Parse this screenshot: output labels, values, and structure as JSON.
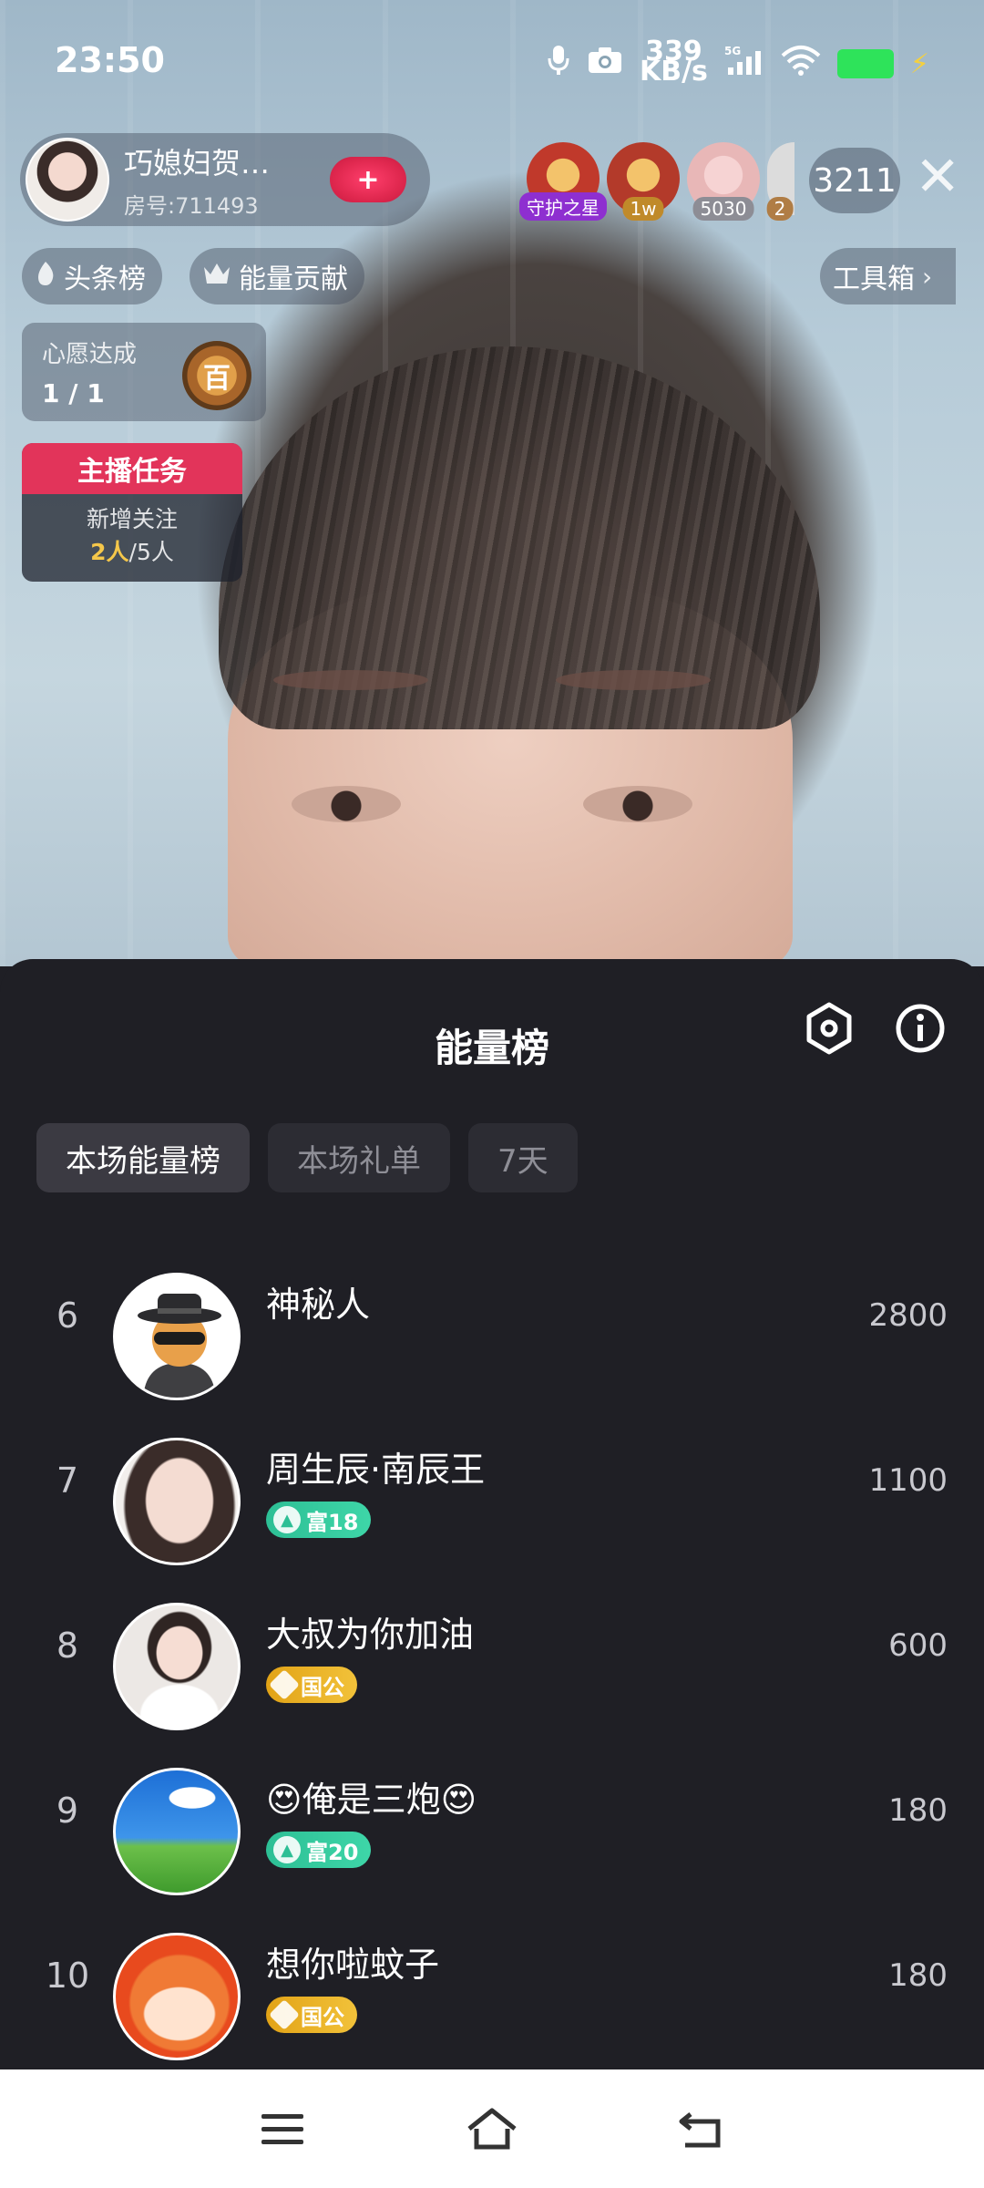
{
  "status_bar": {
    "time": "23:50",
    "net_speed_value": "339",
    "net_speed_unit": "KB/s",
    "network": "5G"
  },
  "host": {
    "name": "巧媳妇贺…",
    "room": "房号:711493",
    "follow_label": "+"
  },
  "viewers": [
    {
      "tag": "守护之星",
      "tag_color": "#8e2fd0",
      "avatar_color": "#c0392b"
    },
    {
      "tag": "1w",
      "tag_color": "#c08a2a",
      "avatar_color": "#b33a2a"
    },
    {
      "tag": "5030",
      "tag_color": "#8d8d95",
      "avatar_color": "#e8b7b7"
    },
    {
      "tag": "2",
      "tag_color": "#b07d45",
      "avatar_color": "#dcdcdc"
    }
  ],
  "viewer_count": "3211",
  "pills": {
    "headline_rank": "头条榜",
    "energy_contribution": "能量贡献",
    "toolbox": "工具箱"
  },
  "wish": {
    "title": "心愿达成",
    "progress": "1 / 1",
    "medal": "百"
  },
  "task": {
    "title": "主播任务",
    "desc": "新增关注",
    "done": "2人",
    "total": "/5人"
  },
  "sheet": {
    "title": "能量榜",
    "tabs": [
      {
        "label": "本场能量榜",
        "active": true
      },
      {
        "label": "本场礼单",
        "active": false
      },
      {
        "label": "7天",
        "active": false
      }
    ],
    "rows": [
      {
        "rank": "6",
        "name": "神秘人",
        "badge": null,
        "badge_label": "",
        "score": "2800",
        "avatar": "mystery"
      },
      {
        "rank": "7",
        "name": "周生辰·南辰王",
        "badge": "fu",
        "badge_label": "富18",
        "score": "1100",
        "avatar": "girl1"
      },
      {
        "rank": "8",
        "name": "大叔为你加油",
        "badge": "guo",
        "badge_label": "国公",
        "score": "600",
        "avatar": "girl2"
      },
      {
        "rank": "9",
        "name": "😍俺是三炮😍",
        "badge": "fu",
        "badge_label": "富20",
        "score": "180",
        "avatar": "sky"
      },
      {
        "rank": "10",
        "name": "想你啦蚊子",
        "badge": "guo",
        "badge_label": "国公",
        "score": "180",
        "avatar": "cat"
      }
    ]
  },
  "colors": {
    "sheet_bg": "#1f1f25",
    "task_header": "#e2345a",
    "badge_fu": "#2dbf95",
    "badge_guo": "#e2a316"
  }
}
